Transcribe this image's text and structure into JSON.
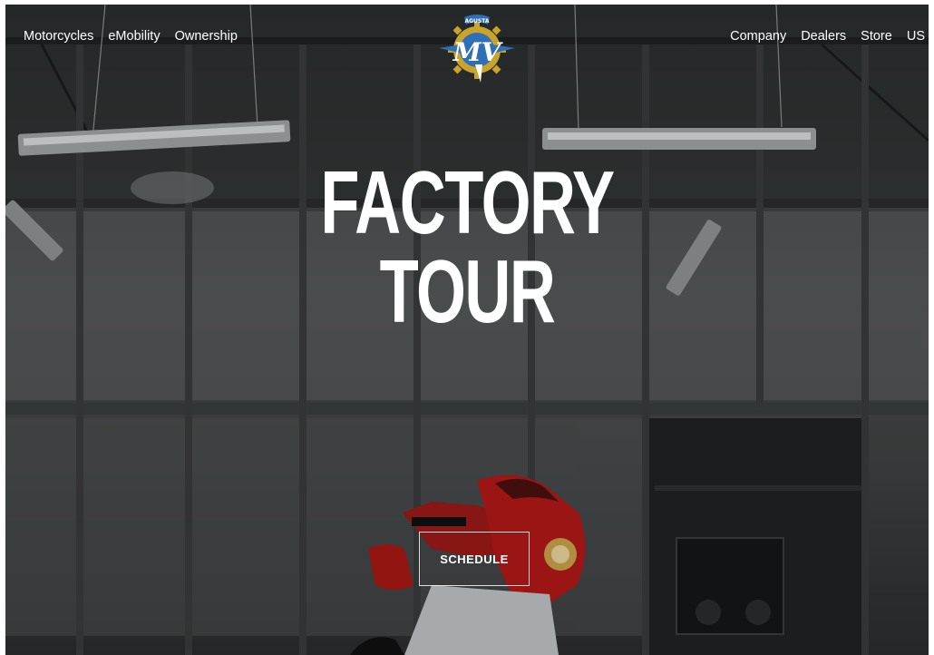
{
  "nav": {
    "left": [
      "Motorcycles",
      "eMobility",
      "Ownership"
    ],
    "right": [
      "Company",
      "Dealers",
      "Store",
      "US"
    ]
  },
  "logo": {
    "text": "AGUSTA",
    "letters": "MV",
    "icon": "mv-agusta-logo-icon"
  },
  "hero": {
    "title_line1": "FACTORY",
    "title_line2": "TOUR",
    "cta_label": "SCHEDULE"
  },
  "colors": {
    "text": "#ffffff",
    "logo_blue": "#2f6fb7",
    "logo_gold": "#c9a32a",
    "bike_red": "#b01916"
  }
}
